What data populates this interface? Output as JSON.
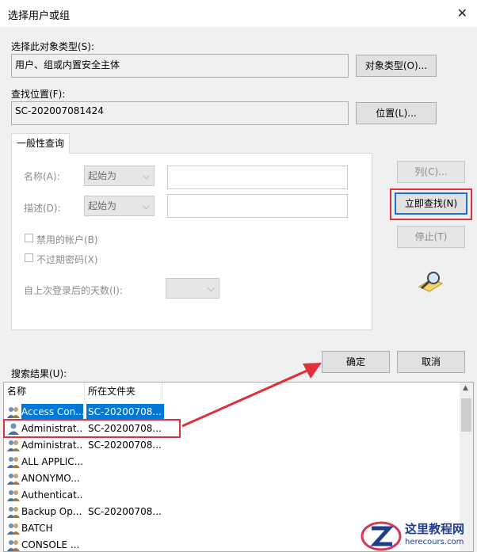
{
  "window": {
    "title": "选择用户或组",
    "close_glyph": "✕"
  },
  "object_type": {
    "label": "选择此对象类型(S):",
    "value": "用户、组或内置安全主体",
    "button": "对象类型(O)..."
  },
  "location": {
    "label": "查找位置(F):",
    "value": "SC-202007081424",
    "button": "位置(L)..."
  },
  "query": {
    "tab": "一般性查询",
    "name_label": "名称(A):",
    "name_op": "起始为",
    "name_value": "",
    "desc_label": "描述(D):",
    "desc_op": "起始为",
    "desc_value": "",
    "disabled_accounts": "禁用的帐户(B)",
    "no_expire": "不过期密码(X)",
    "days_label": "自上次登录后的天数(I):",
    "days_value": ""
  },
  "side_buttons": {
    "columns": "列(C)...",
    "find_now": "立即查找(N)",
    "stop": "停止(T)"
  },
  "dialog_buttons": {
    "ok": "确定",
    "cancel": "取消"
  },
  "results": {
    "label": "搜索结果(U):",
    "columns": [
      "名称",
      "所在文件夹"
    ],
    "rows": [
      {
        "name": "Access Con...",
        "folder": "SC-20200708...",
        "selected": true
      },
      {
        "name": "Administrat...",
        "folder": "SC-20200708...",
        "selected": false
      },
      {
        "name": "Administrat...",
        "folder": "SC-20200708...",
        "selected": false
      },
      {
        "name": "ALL APPLIC...",
        "folder": "",
        "selected": false
      },
      {
        "name": "ANONYMO...",
        "folder": "",
        "selected": false
      },
      {
        "name": "Authenticat...",
        "folder": "",
        "selected": false
      },
      {
        "name": "Backup Op...",
        "folder": "SC-20200708...",
        "selected": false
      },
      {
        "name": "BATCH",
        "folder": "",
        "selected": false
      },
      {
        "name": "CONSOLE ...",
        "folder": "",
        "selected": false
      }
    ]
  },
  "watermark": {
    "text": "这里教程网",
    "url": "herecours.com"
  },
  "colors": {
    "selection": "#0078d7",
    "highlight_box": "#e0303c",
    "arrow": "#e0303c"
  }
}
